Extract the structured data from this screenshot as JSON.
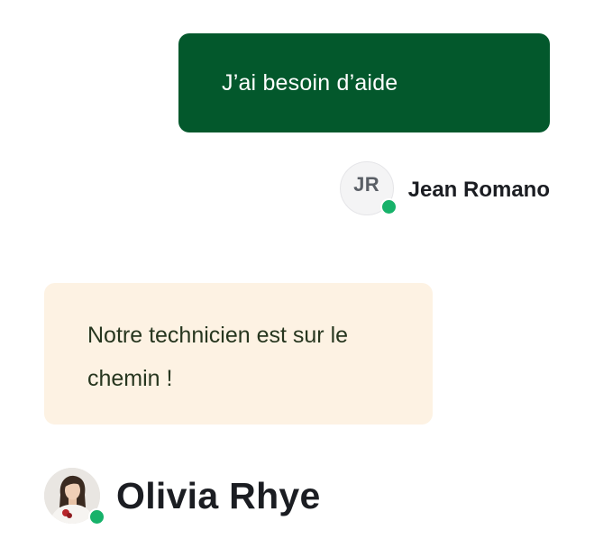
{
  "messages": [
    {
      "direction": "outgoing",
      "text": "J’ai besoin d’aide",
      "sender": {
        "name": "Jean Romano",
        "initials": "JR",
        "status": "online"
      },
      "bubble_color": "#03582c"
    },
    {
      "direction": "incoming",
      "text": "Notre technicien est sur le chemin !",
      "sender": {
        "name": "Olivia Rhye",
        "status": "online"
      },
      "bubble_color": "#fdf2e3"
    }
  ],
  "colors": {
    "online_dot": "#17b26a",
    "name_text": "#1b1d22"
  },
  "icons": {
    "online_indicator": "online-status-dot-icon"
  }
}
